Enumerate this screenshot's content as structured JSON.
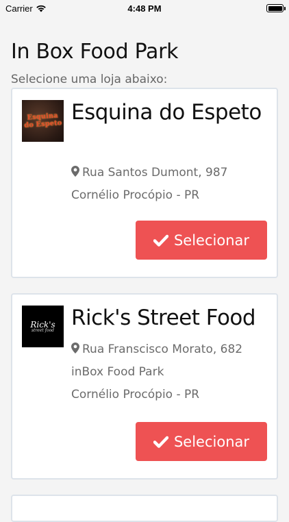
{
  "status_bar": {
    "carrier": "Carrier",
    "time": "4:48 PM"
  },
  "header": {
    "title": "In Box Food Park",
    "subtitle": "Selecione uma loja abaixo:"
  },
  "stores": [
    {
      "logo_text": "Esquina do Espeto",
      "name": "Esquina do Espeto",
      "address_lines": [
        "Rua Santos Dumont, 987",
        "Cornélio Procópio - PR"
      ],
      "button_label": "Selecionar"
    },
    {
      "logo_text": "Rick's",
      "logo_subtext": "street food",
      "name": "Rick's Street Food",
      "address_lines": [
        "Rua Franscisco Morato, 682",
        "inBox Food Park",
        "Cornélio Procópio - PR"
      ],
      "button_label": "Selecionar"
    }
  ],
  "colors": {
    "accent": "#ee5253",
    "background": "#f4f4f4",
    "card_border": "#dde3ea"
  },
  "icons": {
    "map_marker": "map-marker-icon",
    "check": "check-icon",
    "wifi": "wifi-icon",
    "battery": "battery-icon"
  }
}
